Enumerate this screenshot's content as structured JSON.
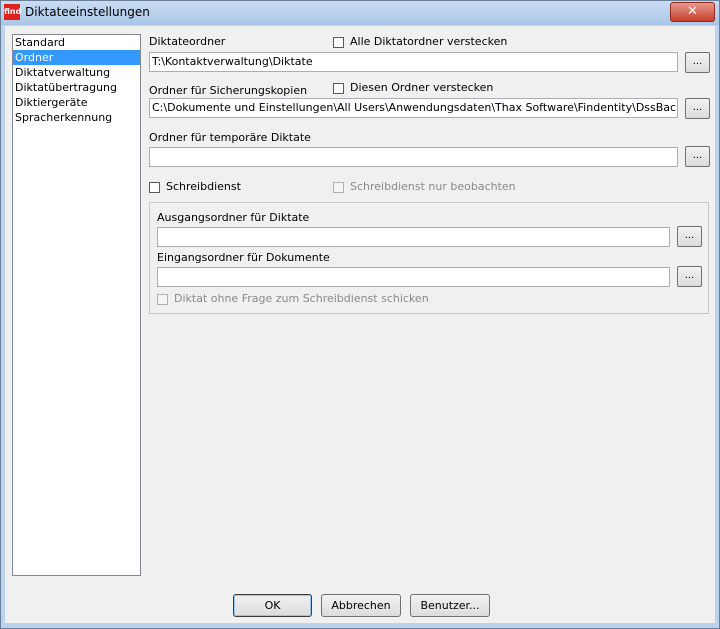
{
  "window": {
    "title": "Diktateeinstellungen",
    "app_icon_text": "find",
    "close_symbol": "✕"
  },
  "sidebar": {
    "items": [
      {
        "label": "Standard"
      },
      {
        "label": "Ordner"
      },
      {
        "label": "Diktatverwaltung"
      },
      {
        "label": "Diktatübertragung"
      },
      {
        "label": "Diktiergeräte"
      },
      {
        "label": "Spracherkennung"
      }
    ],
    "selected_index": 1
  },
  "dictation_folder": {
    "label": "Diktateordner",
    "value": "T:\\Kontaktverwaltung\\Diktate",
    "hide_all_label": "Alle Diktatordner verstecken",
    "hide_all_checked": false,
    "browse_label": "..."
  },
  "backup_folder": {
    "label": "Ordner für Sicherungskopien",
    "value": "C:\\Dokumente und Einstellungen\\All Users\\Anwendungsdaten\\Thax Software\\Findentity\\DssBackup",
    "hide_label": "Diesen Ordner verstecken",
    "hide_checked": false,
    "browse_label": "..."
  },
  "temp_folder": {
    "label": "Ordner für temporäre Diktate",
    "value": "",
    "browse_label": "..."
  },
  "typing_service": {
    "label": "Schreibdienst",
    "checked": false,
    "observe_label": "Schreibdienst nur beobachten",
    "observe_enabled": false,
    "outbox_label": "Ausgangsordner für Diktate",
    "outbox_value": "",
    "inbox_label": "Eingangsordner für Dokumente",
    "inbox_value": "",
    "send_without_asking_label": "Diktat ohne Frage zum Schreibdienst schicken",
    "send_without_asking_enabled": false,
    "browse_label": "..."
  },
  "footer": {
    "ok_label": "OK",
    "cancel_label": "Abbrechen",
    "user_label": "Benutzer..."
  }
}
